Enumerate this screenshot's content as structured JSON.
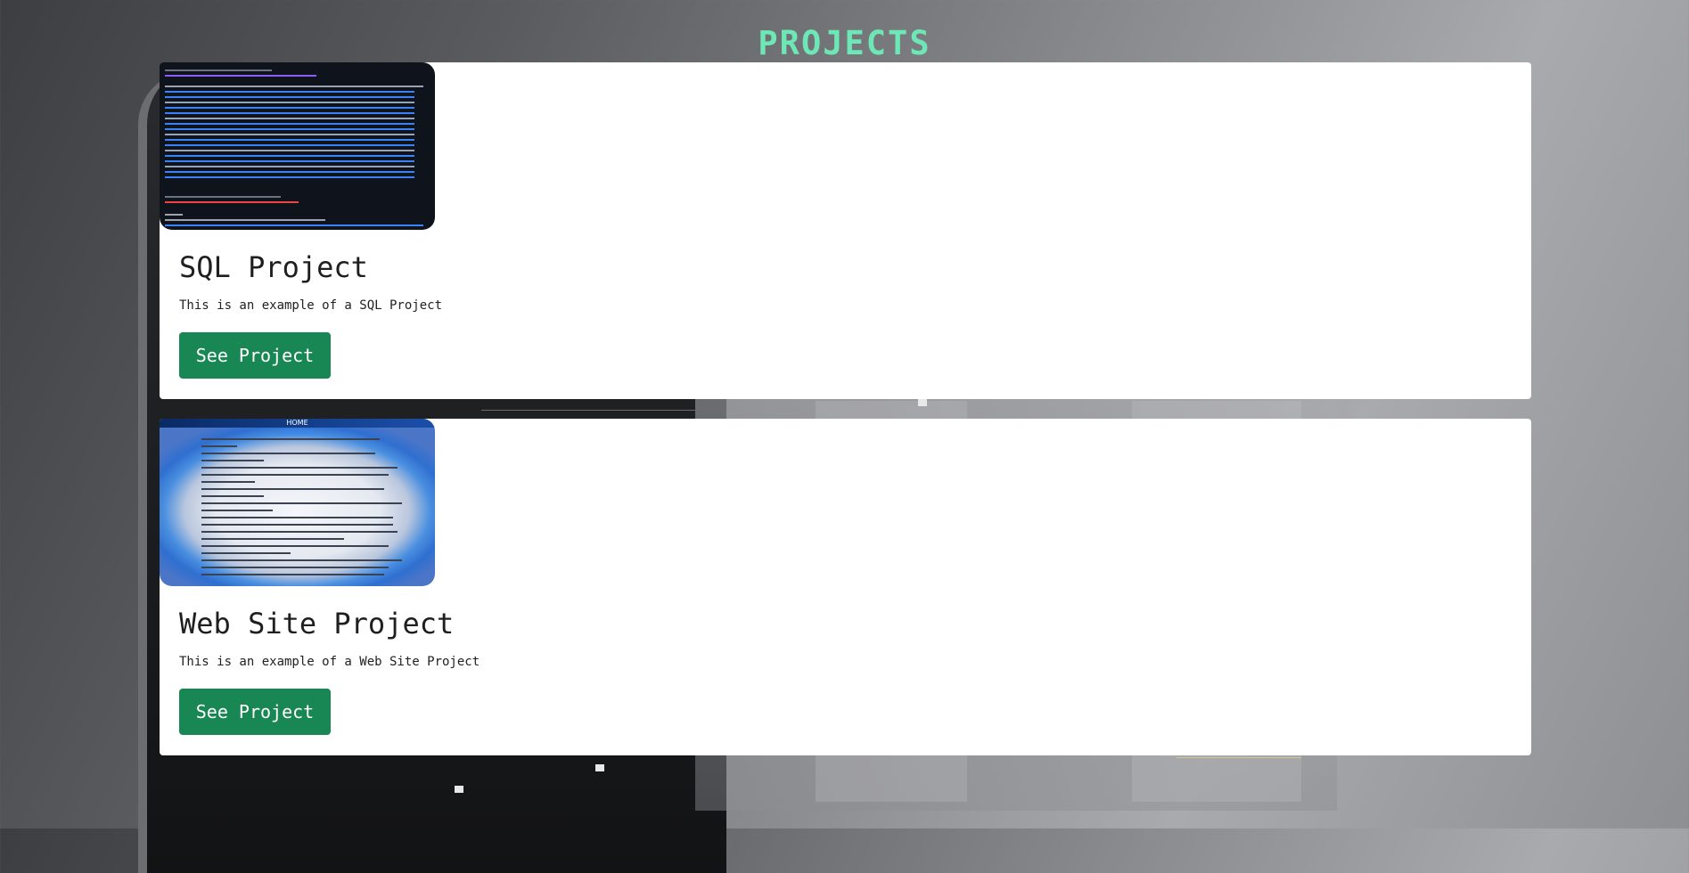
{
  "page": {
    "title": "PROJECTS",
    "title_color": "#6ee7b7"
  },
  "projects": [
    {
      "title": "SQL Project",
      "description": "This is an example of a SQL Project",
      "button_label": "See Project",
      "thumbnail": "sql-query-screenshot"
    },
    {
      "title": "Web Site Project",
      "description": "This is an example of a Web Site Project",
      "button_label": "See Project",
      "thumbnail": "website-screenshot",
      "thumbnail_text": {
        "nav": "HOME",
        "heading": "HEDEFLER"
      }
    }
  ],
  "colors": {
    "button": "#198754",
    "card": "#ffffff"
  }
}
